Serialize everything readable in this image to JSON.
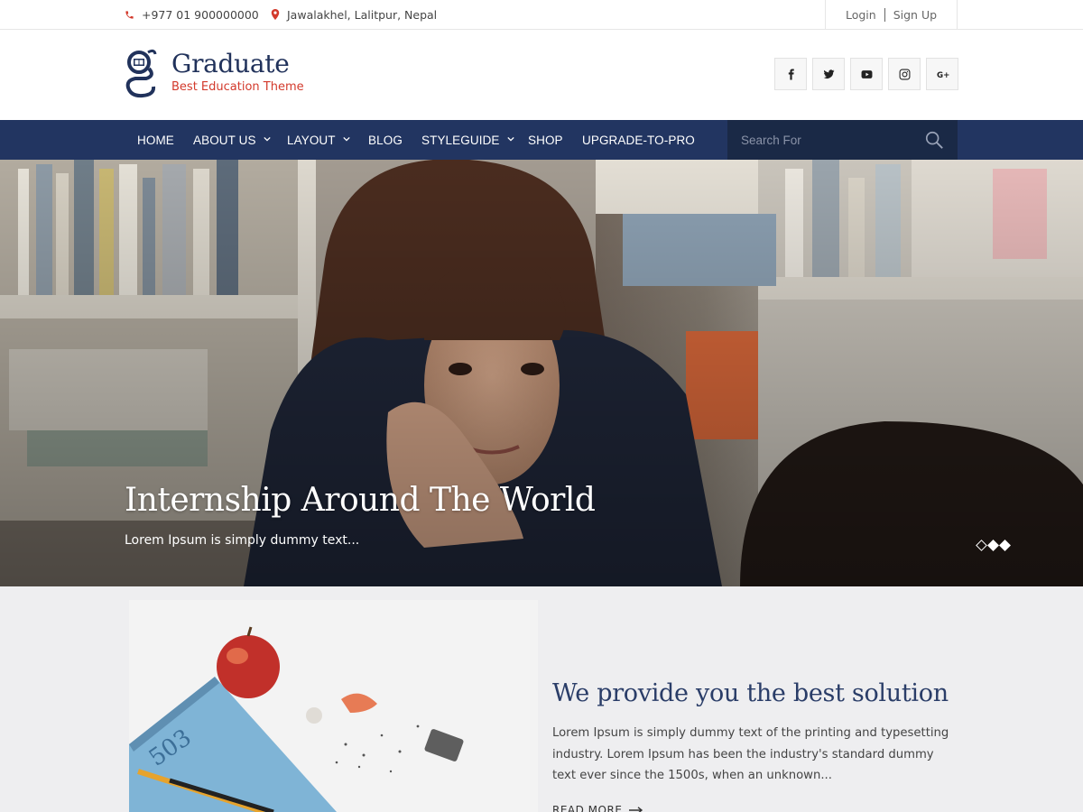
{
  "topbar": {
    "phone": "+977 01 900000000",
    "address": "Jawalakhel, Lalitpur, Nepal",
    "login": "Login",
    "signup": "Sign Up"
  },
  "header": {
    "site_title": "Graduate",
    "tagline": "Best Education Theme",
    "social": [
      "facebook-icon",
      "twitter-icon",
      "youtube-icon",
      "instagram-icon",
      "google-plus-icon"
    ]
  },
  "nav": {
    "items": [
      {
        "label": "HOME",
        "active": true,
        "dropdown": false
      },
      {
        "label": "ABOUT US",
        "active": false,
        "dropdown": true
      },
      {
        "label": "LAYOUT",
        "active": false,
        "dropdown": true
      },
      {
        "label": "BLOG",
        "active": false,
        "dropdown": false
      },
      {
        "label": "STYLEGUIDE",
        "active": false,
        "dropdown": true
      },
      {
        "label": "SHOP",
        "active": false,
        "dropdown": false
      },
      {
        "label": "UPGRADE-TO-PRO",
        "active": false,
        "dropdown": false
      }
    ],
    "search_placeholder": "Search For"
  },
  "hero": {
    "title": "Internship Around The World",
    "subtitle": "Lorem Ipsum is simply dummy text...",
    "slide_count": 3,
    "active_slide": 1
  },
  "feature": {
    "title": "We provide you the best solution",
    "text": "Lorem Ipsum is simply dummy text of the printing and typesetting industry. Lorem Ipsum has been the industry's standard dummy text ever since the 1500s, when an unknown...",
    "read_more": "READ MORE"
  },
  "colors": {
    "nav_bg": "#223561",
    "accent_red": "#d33a2c",
    "heading_blue": "#2a3d68"
  }
}
